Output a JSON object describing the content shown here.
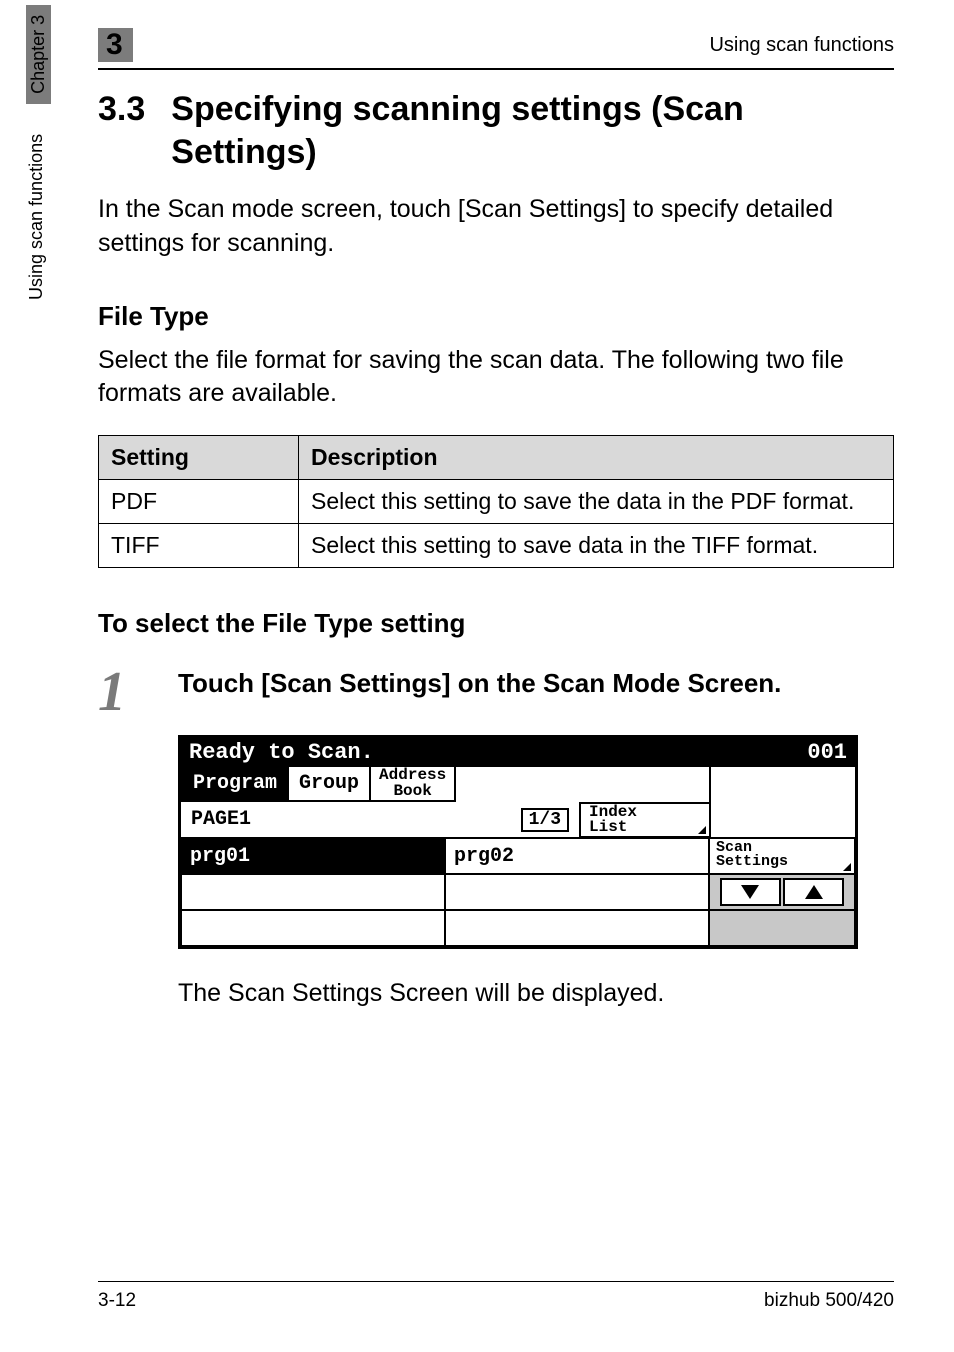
{
  "header": {
    "chapter_num": "3",
    "running_head": "Using scan functions"
  },
  "side": {
    "chapter_label": "Chapter 3",
    "section_label": "Using scan functions"
  },
  "section": {
    "number": "3.3",
    "title": "Specifying scanning settings (Scan Settings)",
    "intro": "In the Scan mode screen, touch [Scan Settings] to specify detailed settings for scanning."
  },
  "filetype": {
    "heading": "File Type",
    "desc": "Select the file format for saving the scan data. The following two file formats are available.",
    "table": {
      "col1": "Setting",
      "col2": "Description",
      "rows": [
        {
          "setting": "PDF",
          "desc": "Select this setting to save the data in the PDF format."
        },
        {
          "setting": "TIFF",
          "desc": "Select this setting to save data in the TIFF format."
        }
      ]
    }
  },
  "procedure": {
    "heading": "To select the File Type setting",
    "step_num": "1",
    "step_text": "Touch [Scan Settings] on the Scan Mode Screen.",
    "result": "The Scan Settings Screen will be displayed."
  },
  "screen": {
    "status": "Ready to Scan.",
    "counter": "001",
    "tab_program": "Program",
    "tab_group": "Group",
    "tab_addr1": "Address",
    "tab_addr2": "Book",
    "page_label": "PAGE1",
    "page_num": "1/3",
    "index1": "Index",
    "index2": "List",
    "prg01": "prg01",
    "prg02": "prg02",
    "scan1": "Scan",
    "scan2": "Settings"
  },
  "footer": {
    "page": "3-12",
    "model": "bizhub 500/420"
  }
}
